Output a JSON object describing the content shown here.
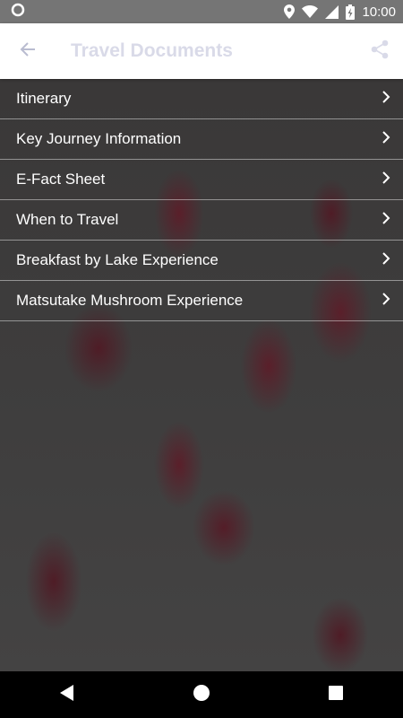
{
  "status_bar": {
    "time": "10:00",
    "icons": [
      "circle-notification-icon",
      "location-icon",
      "wifi-icon",
      "signal-icon",
      "battery-charging-icon"
    ]
  },
  "app_bar": {
    "title": "Travel Documents",
    "back_icon": "arrow-left-icon",
    "share_icon": "share-icon",
    "title_color": "#d9dae8"
  },
  "menu": {
    "items": [
      {
        "label": "Itinerary"
      },
      {
        "label": "Key Journey Information"
      },
      {
        "label": "E-Fact Sheet"
      },
      {
        "label": "When to Travel"
      },
      {
        "label": "Breakfast by Lake Experience"
      },
      {
        "label": "Matsutake Mushroom Experience"
      }
    ],
    "chevron_icon": "chevron-right-icon"
  },
  "nav_bar": {
    "buttons": [
      "back-triangle-icon",
      "home-circle-icon",
      "recents-square-icon"
    ]
  }
}
